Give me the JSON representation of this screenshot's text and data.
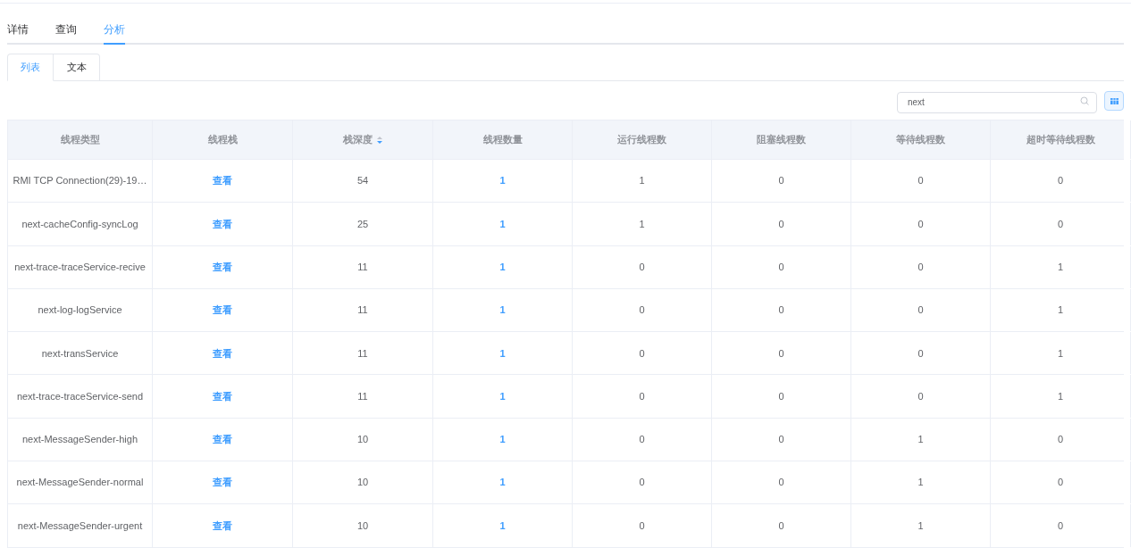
{
  "tabs": [
    {
      "label": "详情",
      "selected": false
    },
    {
      "label": "查询",
      "selected": false
    },
    {
      "label": "分析",
      "selected": true
    }
  ],
  "sub_tabs": [
    {
      "label": "列表",
      "selected": true
    },
    {
      "label": "文本",
      "selected": false
    }
  ],
  "search": {
    "value": "next"
  },
  "table": {
    "columns": [
      {
        "label": "线程类型",
        "sortable": false
      },
      {
        "label": "线程栈",
        "sortable": false
      },
      {
        "label": "栈深度",
        "sortable": true
      },
      {
        "label": "线程数量",
        "sortable": false
      },
      {
        "label": "运行线程数",
        "sortable": false
      },
      {
        "label": "阻塞线程数",
        "sortable": false
      },
      {
        "label": "等待线程数",
        "sortable": false
      },
      {
        "label": "超时等待线程数",
        "sortable": false
      }
    ],
    "rows": [
      [
        "RMI TCP Connection(29)-19…",
        "查看",
        "54",
        "1",
        "1",
        "0",
        "0",
        "0"
      ],
      [
        "next-cacheConfig-syncLog",
        "查看",
        "25",
        "1",
        "1",
        "0",
        "0",
        "0"
      ],
      [
        "next-trace-traceService-recive",
        "查看",
        "11",
        "1",
        "0",
        "0",
        "0",
        "1"
      ],
      [
        "next-log-logService",
        "查看",
        "11",
        "1",
        "0",
        "0",
        "0",
        "1"
      ],
      [
        "next-transService",
        "查看",
        "11",
        "1",
        "0",
        "0",
        "0",
        "1"
      ],
      [
        "next-trace-traceService-send",
        "查看",
        "11",
        "1",
        "0",
        "0",
        "0",
        "1"
      ],
      [
        "next-MessageSender-high",
        "查看",
        "10",
        "1",
        "0",
        "0",
        "1",
        "0"
      ],
      [
        "next-MessageSender-normal",
        "查看",
        "10",
        "1",
        "0",
        "0",
        "1",
        "0"
      ],
      [
        "next-MessageSender-urgent",
        "查看",
        "10",
        "1",
        "0",
        "0",
        "1",
        "0"
      ]
    ]
  }
}
